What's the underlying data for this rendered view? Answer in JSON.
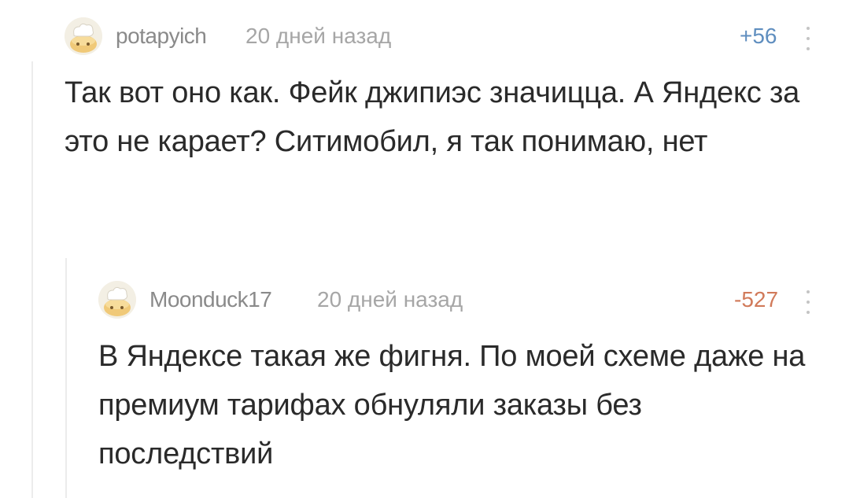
{
  "comments": [
    {
      "username": "potapyich",
      "time": "20 дней назад",
      "rating": "+56",
      "rating_color": "#5f8ebf",
      "avatar_icon": "chef-hat-avatar-icon",
      "text": "Так вот оно как. Фейк джипиэс значицца. А Яндекс за это не карает? Ситимобил, я так понимаю, нет"
    },
    {
      "username": "Moonduck17",
      "time": "20 дней назад",
      "rating": "-527",
      "rating_color": "#d17a5a",
      "avatar_icon": "chef-hat-avatar-icon",
      "text": "В Яндексе такая же фигня. По моей схеме даже на премиум тарифах обнуляли заказы без последствий"
    }
  ]
}
